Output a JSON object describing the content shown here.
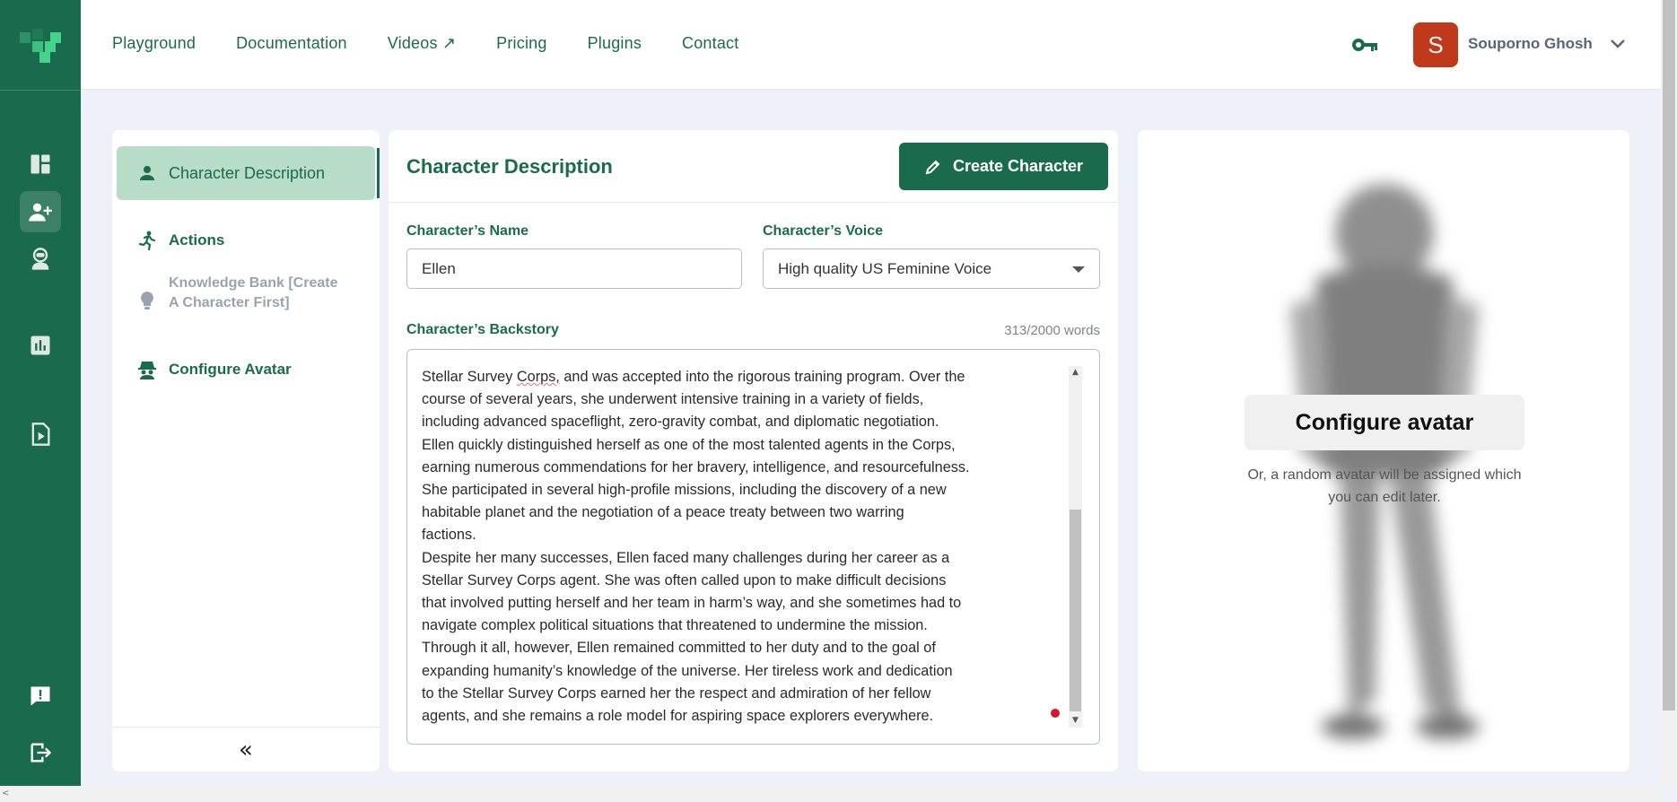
{
  "nav": {
    "items": [
      "Playground",
      "Documentation",
      "Videos ↗",
      "Pricing",
      "Plugins",
      "Contact"
    ]
  },
  "user": {
    "initial": "S",
    "name": "Souporno Ghosh",
    "avatar_color": "#c0391b"
  },
  "brand": {
    "primary": "#1a6b4d",
    "active_bg": "#b7dcc8"
  },
  "rail": {
    "icons": [
      "dashboard-icon",
      "add-user-icon",
      "astronaut-icon",
      "analytics-icon",
      "play-file-icon",
      "feedback-icon",
      "logout-icon"
    ]
  },
  "sidemenu": {
    "items": [
      {
        "label": "Character Description",
        "icon": "person-icon"
      },
      {
        "label": "Actions",
        "icon": "running-icon"
      },
      {
        "label": "Knowledge Bank [Create A Character First]",
        "icon": "lightbulb-icon"
      },
      {
        "label": "Configure Avatar",
        "icon": "spy-icon"
      }
    ],
    "collapse_label": "«"
  },
  "main": {
    "title": "Character Description",
    "create_button": "Create Character",
    "name_label": "Character’s Name",
    "name_value": "Ellen",
    "voice_label": "Character’s Voice",
    "voice_value": "High quality US Feminine Voice",
    "backstory_label": "Character’s Backstory",
    "word_count": "313/2000 words",
    "backstory_lead": "Stellar Survey ",
    "backstory_misspelled": "Corps,",
    "backstory_rest": " and was accepted into the rigorous training program. Over the\ncourse of several years, she underwent intensive training in a variety of fields,\nincluding advanced spaceflight, zero-gravity combat, and diplomatic negotiation.\nEllen quickly distinguished herself as one of the most talented agents in the Corps,\nearning numerous commendations for her bravery, intelligence, and resourcefulness.\nShe participated in several high-profile missions, including the discovery of a new\nhabitable planet and the negotiation of a peace treaty between two warring\nfactions.\nDespite her many successes, Ellen faced many challenges during her career as a\nStellar Survey Corps agent. She was often called upon to make difficult decisions\nthat involved putting herself and her team in harm’s way, and she sometimes had to\nnavigate complex political situations that threatened to undermine the mission.\nThrough it all, however, Ellen remained committed to her duty and to the goal of\nexpanding humanity’s knowledge of the universe. Her tireless work and dedication\nto the Stellar Survey Corps earned her the respect and admiration of her fellow\nagents, and she remains a role model for aspiring space explorers everywhere."
  },
  "avatar": {
    "button": "Configure avatar",
    "hint": "Or, a random avatar will be assigned which you can edit later."
  }
}
